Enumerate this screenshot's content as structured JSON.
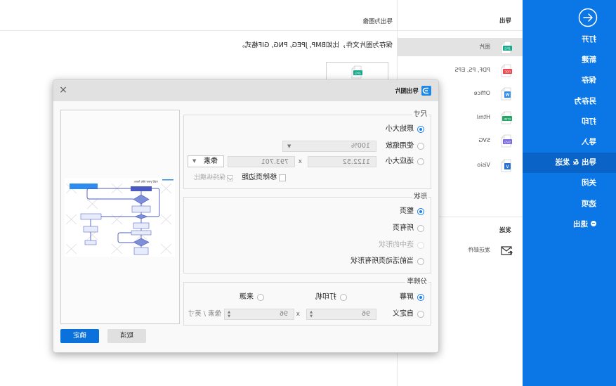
{
  "colors": {
    "sidebar_bg": "#0b77e6",
    "sidebar_selected": "#0a63c7",
    "accent": "#1a7fe8",
    "primary_button": "#0b72dc"
  },
  "sidebar": {
    "back_icon": "arrow-left-circle-icon",
    "items": [
      {
        "label": "打开"
      },
      {
        "label": "新建"
      },
      {
        "label": "保存"
      },
      {
        "label": "另存为"
      },
      {
        "label": "打印"
      },
      {
        "label": "导入"
      },
      {
        "label": "导出 & 发送",
        "selected": true
      },
      {
        "label": "关闭"
      },
      {
        "label": "选项"
      },
      {
        "label": "退出",
        "icon": "minus-circle-icon"
      }
    ]
  },
  "export_panel": {
    "title": "导出",
    "items": [
      {
        "label": "图片",
        "badge": "JPG",
        "badge_color": "#17a98c",
        "selected": true
      },
      {
        "label": "PDF, PS, EPS",
        "badge": "PDF",
        "badge_color": "#f0454f"
      },
      {
        "label": "Office",
        "badge": "W",
        "badge_color": "#2f8ef0"
      },
      {
        "label": "Html",
        "badge": "HTML",
        "badge_color": "#23a566"
      },
      {
        "label": "SVG",
        "badge": "SVG",
        "badge_color": "#7a6ae0"
      },
      {
        "label": "Visio",
        "badge": "V",
        "badge_color": "#2a6fd6"
      }
    ],
    "send_title": "发送",
    "send_items": [
      {
        "label": "发送邮件",
        "icon": "mail-icon"
      }
    ]
  },
  "main": {
    "title": "导出为图像",
    "description": "保存为图片文件，比如BMP, JPEG, PNG, GIF格式。",
    "card_badge": "JPG",
    "card_badge_color": "#17a98c"
  },
  "dialog": {
    "title": "导出图片",
    "close_glyph": "×",
    "preview": {
      "title": "Add your title here."
    },
    "size": {
      "legend": "尺寸",
      "original_label": "原始大小",
      "scale_label": "使用缩放",
      "scale_value": "100%",
      "fit_label": "适应大小",
      "width_value": "1122.52",
      "height_value": "793.701",
      "times": "x",
      "unit_value": "像素",
      "remove_margin_label": "移除页边距",
      "remove_margin_checked": false,
      "keep_ratio_label": "保持纵横比",
      "keep_ratio_checked": true,
      "selected": "原始大小"
    },
    "shape": {
      "legend": "形状",
      "options": [
        "整页",
        "所有页",
        "选中的形状",
        "当前活动页所有形状"
      ],
      "selected": "整页",
      "disabled": [
        "选中的形状"
      ]
    },
    "resolution": {
      "legend": "分辨率",
      "screen_label": "屏幕",
      "printer_label": "打印机",
      "source_label": "来源",
      "custom_label": "自定义",
      "dpi_x": "96",
      "dpi_y": "96",
      "times": "x",
      "unit_label": "像素 / 英寸",
      "selected": "屏幕"
    },
    "ok_label": "确定",
    "cancel_label": "取消"
  }
}
